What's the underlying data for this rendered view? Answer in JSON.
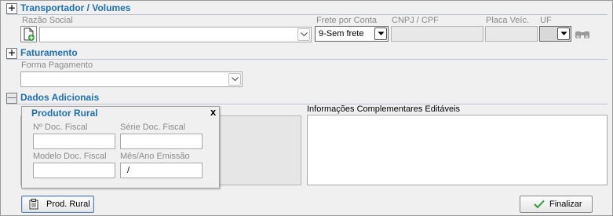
{
  "sections": {
    "transportador": {
      "title": "Transportador / Volumes",
      "toggle": "+"
    },
    "faturamento": {
      "title": "Faturamento",
      "toggle": "+"
    },
    "dados_adicionais": {
      "title": "Dados Adicionais",
      "toggle": "—"
    }
  },
  "transportador": {
    "razao_social_label": "Razão Social",
    "razao_social_value": "",
    "frete_label": "Frete por Conta",
    "frete_value": "9-Sem frete",
    "cnpj_label": "CNPJ / CPF",
    "cnpj_value": "",
    "placa_label": "Placa Veíc.",
    "placa_value": "",
    "uf_label": "UF",
    "uf_value": ""
  },
  "faturamento": {
    "forma_pagamento_label": "Forma Pagamento",
    "forma_pagamento_value": ""
  },
  "produtor_rural": {
    "title": "Produtor Rural",
    "close": "x",
    "num_doc_label": "Nº Doc. Fiscal",
    "num_doc_value": "",
    "serie_label": "Série Doc. Fiscal",
    "serie_value": "",
    "modelo_label": "Modelo Doc. Fiscal",
    "modelo_value": "",
    "mes_ano_label": "Mês/Ano Emissão",
    "mes_ano_value": "/"
  },
  "dados_adicionais": {
    "info_complementares_label": "Informações Complementares Editáveis",
    "info_complementares_value": ""
  },
  "buttons": {
    "prod_rural": "Prod. Rural",
    "finalizar": "Finalizar"
  },
  "colors": {
    "section_title": "#1f6fb3",
    "check_icon": "#2e9a3a"
  }
}
